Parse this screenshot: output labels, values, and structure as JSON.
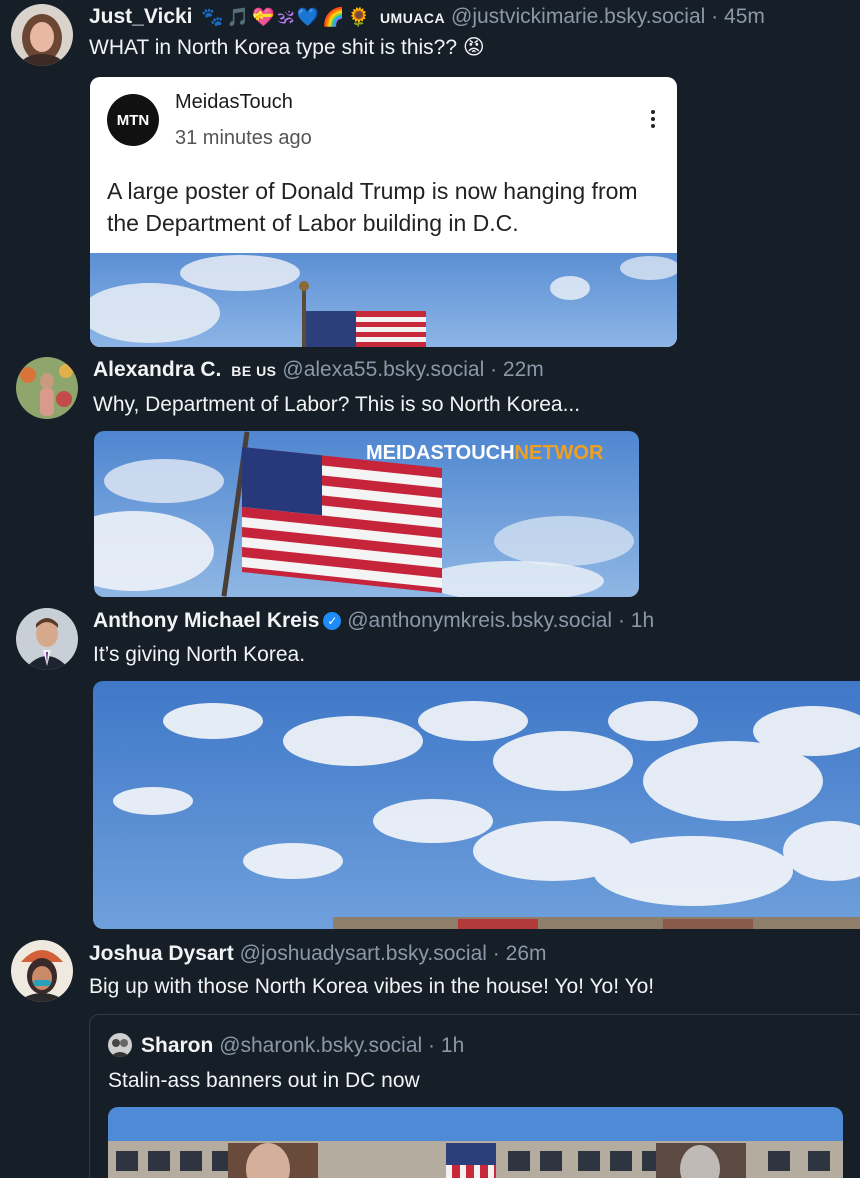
{
  "posts": [
    {
      "display_name": "Just_Vicki",
      "badges": [
        "🐾",
        "🎵",
        "💝",
        "🕉",
        "💙",
        "🌈",
        "🌻"
      ],
      "tag": "UMUACA",
      "handle": "@justvickimarie.bsky.social",
      "time": "45m",
      "text": "WHAT in North Korea type shit is this?? 😡",
      "embed": {
        "source_name": "MeidasTouch",
        "source_logo_text": "MTN",
        "source_time": "31 minutes ago",
        "text": "A large poster of Donald Trump is now hanging from the Department of Labor building in D.C."
      }
    },
    {
      "display_name": "Alexandra C.",
      "tag": "BE US",
      "handle": "@alexa55.bsky.social",
      "time": "22m",
      "text": "Why, Department of Labor? This is so North Korea...",
      "image_overlay_a": "MEIDASTOUCH",
      "image_overlay_b": "NETWOR"
    },
    {
      "display_name": "Anthony Michael Kreis",
      "handle": "@anthonymkreis.bsky.social",
      "time": "1h",
      "text": "It’s giving North Korea."
    },
    {
      "display_name": "Joshua Dysart",
      "handle": "@joshuadysart.bsky.social",
      "time": "26m",
      "text": "Big up with those North Korea vibes in the house! Yo! Yo! Yo!",
      "quote": {
        "display_name": "Sharon",
        "handle": "@sharonk.bsky.social",
        "time": "1h",
        "text": "Stalin-ass banners out in DC now"
      }
    }
  ],
  "sep": "·"
}
